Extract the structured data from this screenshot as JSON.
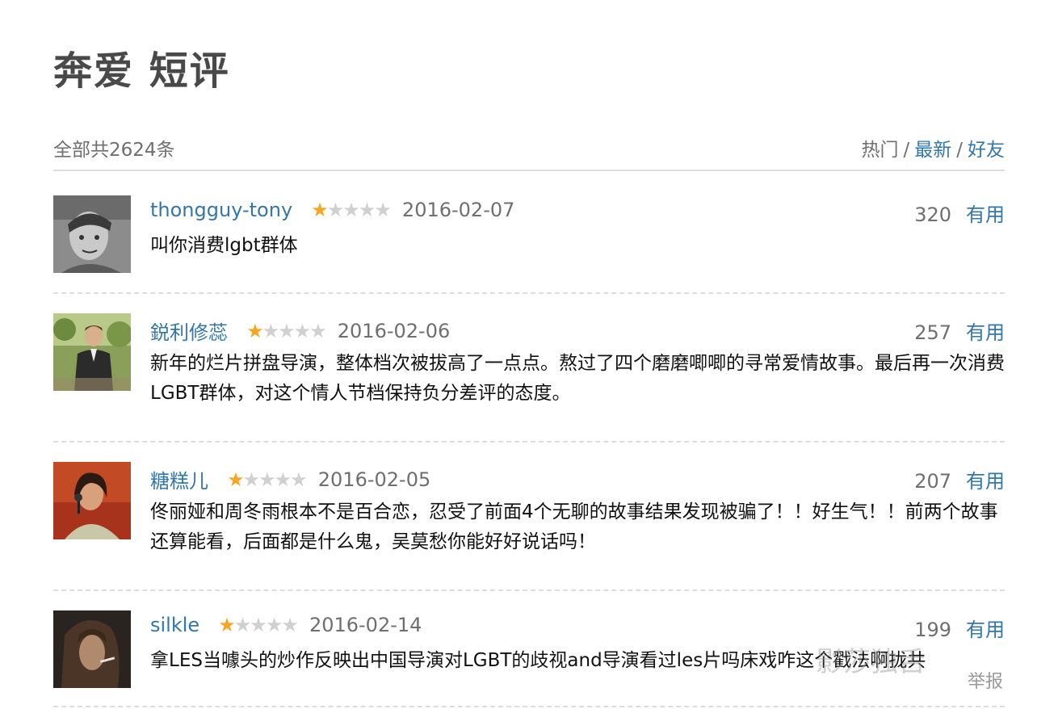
{
  "page": {
    "title": "奔爱 短评"
  },
  "summary": {
    "total": "全部共2624条",
    "sort": {
      "hot": "热门",
      "latest": "最新",
      "friends": "好友",
      "sep": "/"
    }
  },
  "comments": [
    {
      "username": "thongguy-tony",
      "rating": 1,
      "max_rating": 5,
      "date": "2016-02-07",
      "votes": "320",
      "useful_label": "有用",
      "text": "叫你消费lgbt群体",
      "avatar_icon": "sketch-portrait"
    },
    {
      "username": "鋭利修蕊",
      "rating": 1,
      "max_rating": 5,
      "date": "2016-02-06",
      "votes": "257",
      "useful_label": "有用",
      "text": "新年的烂片拼盘导演，整体档次被拔高了一点点。熬过了四个磨磨唧唧的寻常爱情故事。最后再一次消费LGBT群体，对这个情人节档保持负分差评的态度。",
      "avatar_icon": "man-in-suit-photo"
    },
    {
      "username": "糖糕儿",
      "rating": 1,
      "max_rating": 5,
      "date": "2016-02-05",
      "votes": "207",
      "useful_label": "有用",
      "text": "佟丽娅和周冬雨根本不是百合恋，忍受了前面4个无聊的故事结果发现被骗了！！好生气！！前两个故事还算能看，后面都是什么鬼，吴莫愁你能好好说话吗！",
      "avatar_icon": "singer-photo"
    },
    {
      "username": "silkle",
      "rating": 1,
      "max_rating": 5,
      "date": "2016-02-14",
      "votes": "199",
      "useful_label": "有用",
      "text": "拿LES当噱头的炒作反映出中国导演对LGBT的歧视and导演看过les片吗床戏咋这个戳法啊拢共",
      "avatar_icon": "dark-portrait-photo"
    }
  ],
  "watermark": "影莎独舌",
  "report": "举报",
  "colors": {
    "link": "#3377aa",
    "star_on": "#f7a623",
    "star_off": "#d0d0d0",
    "muted": "#6f6f6f"
  }
}
